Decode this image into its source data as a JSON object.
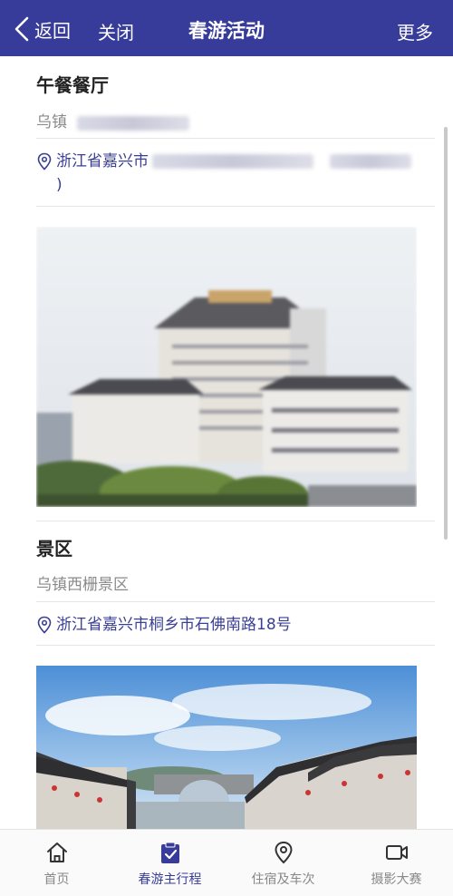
{
  "header": {
    "back_label": "返回",
    "close_label": "关闭",
    "title": "春游活动",
    "more_label": "更多"
  },
  "lunch": {
    "title": "午餐餐厅",
    "name_prefix": "乌镇",
    "address_prefix": "浙江省嘉兴市",
    "address_suffix": ")"
  },
  "scenic": {
    "title": "景区",
    "name": "乌镇西栅景区",
    "address": "浙江省嘉兴市桐乡市石佛南路18号"
  },
  "bottom_nav": {
    "items": [
      {
        "label": "首页",
        "icon": "home-icon"
      },
      {
        "label": "春游主行程",
        "icon": "clipboard-check-icon"
      },
      {
        "label": "住宿及车次",
        "icon": "location-pin-icon"
      },
      {
        "label": "摄影大赛",
        "icon": "video-camera-icon"
      }
    ],
    "active_index": 1
  },
  "colors": {
    "header_bg": "#373b9a",
    "accent": "#3a3f94",
    "muted_text": "#8a8a8a"
  }
}
